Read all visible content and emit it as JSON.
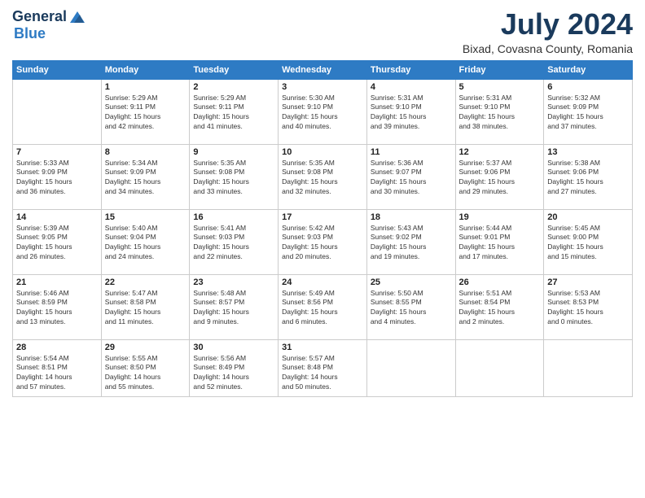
{
  "header": {
    "logo": {
      "line1": "General",
      "line2": "Blue"
    },
    "title": "July 2024",
    "location": "Bixad, Covasna County, Romania"
  },
  "weekdays": [
    "Sunday",
    "Monday",
    "Tuesday",
    "Wednesday",
    "Thursday",
    "Friday",
    "Saturday"
  ],
  "weeks": [
    [
      {
        "day": null,
        "info": null
      },
      {
        "day": "1",
        "info": "Sunrise: 5:29 AM\nSunset: 9:11 PM\nDaylight: 15 hours\nand 42 minutes."
      },
      {
        "day": "2",
        "info": "Sunrise: 5:29 AM\nSunset: 9:11 PM\nDaylight: 15 hours\nand 41 minutes."
      },
      {
        "day": "3",
        "info": "Sunrise: 5:30 AM\nSunset: 9:10 PM\nDaylight: 15 hours\nand 40 minutes."
      },
      {
        "day": "4",
        "info": "Sunrise: 5:31 AM\nSunset: 9:10 PM\nDaylight: 15 hours\nand 39 minutes."
      },
      {
        "day": "5",
        "info": "Sunrise: 5:31 AM\nSunset: 9:10 PM\nDaylight: 15 hours\nand 38 minutes."
      },
      {
        "day": "6",
        "info": "Sunrise: 5:32 AM\nSunset: 9:09 PM\nDaylight: 15 hours\nand 37 minutes."
      }
    ],
    [
      {
        "day": "7",
        "info": "Sunrise: 5:33 AM\nSunset: 9:09 PM\nDaylight: 15 hours\nand 36 minutes."
      },
      {
        "day": "8",
        "info": "Sunrise: 5:34 AM\nSunset: 9:09 PM\nDaylight: 15 hours\nand 34 minutes."
      },
      {
        "day": "9",
        "info": "Sunrise: 5:35 AM\nSunset: 9:08 PM\nDaylight: 15 hours\nand 33 minutes."
      },
      {
        "day": "10",
        "info": "Sunrise: 5:35 AM\nSunset: 9:08 PM\nDaylight: 15 hours\nand 32 minutes."
      },
      {
        "day": "11",
        "info": "Sunrise: 5:36 AM\nSunset: 9:07 PM\nDaylight: 15 hours\nand 30 minutes."
      },
      {
        "day": "12",
        "info": "Sunrise: 5:37 AM\nSunset: 9:06 PM\nDaylight: 15 hours\nand 29 minutes."
      },
      {
        "day": "13",
        "info": "Sunrise: 5:38 AM\nSunset: 9:06 PM\nDaylight: 15 hours\nand 27 minutes."
      }
    ],
    [
      {
        "day": "14",
        "info": "Sunrise: 5:39 AM\nSunset: 9:05 PM\nDaylight: 15 hours\nand 26 minutes."
      },
      {
        "day": "15",
        "info": "Sunrise: 5:40 AM\nSunset: 9:04 PM\nDaylight: 15 hours\nand 24 minutes."
      },
      {
        "day": "16",
        "info": "Sunrise: 5:41 AM\nSunset: 9:03 PM\nDaylight: 15 hours\nand 22 minutes."
      },
      {
        "day": "17",
        "info": "Sunrise: 5:42 AM\nSunset: 9:03 PM\nDaylight: 15 hours\nand 20 minutes."
      },
      {
        "day": "18",
        "info": "Sunrise: 5:43 AM\nSunset: 9:02 PM\nDaylight: 15 hours\nand 19 minutes."
      },
      {
        "day": "19",
        "info": "Sunrise: 5:44 AM\nSunset: 9:01 PM\nDaylight: 15 hours\nand 17 minutes."
      },
      {
        "day": "20",
        "info": "Sunrise: 5:45 AM\nSunset: 9:00 PM\nDaylight: 15 hours\nand 15 minutes."
      }
    ],
    [
      {
        "day": "21",
        "info": "Sunrise: 5:46 AM\nSunset: 8:59 PM\nDaylight: 15 hours\nand 13 minutes."
      },
      {
        "day": "22",
        "info": "Sunrise: 5:47 AM\nSunset: 8:58 PM\nDaylight: 15 hours\nand 11 minutes."
      },
      {
        "day": "23",
        "info": "Sunrise: 5:48 AM\nSunset: 8:57 PM\nDaylight: 15 hours\nand 9 minutes."
      },
      {
        "day": "24",
        "info": "Sunrise: 5:49 AM\nSunset: 8:56 PM\nDaylight: 15 hours\nand 6 minutes."
      },
      {
        "day": "25",
        "info": "Sunrise: 5:50 AM\nSunset: 8:55 PM\nDaylight: 15 hours\nand 4 minutes."
      },
      {
        "day": "26",
        "info": "Sunrise: 5:51 AM\nSunset: 8:54 PM\nDaylight: 15 hours\nand 2 minutes."
      },
      {
        "day": "27",
        "info": "Sunrise: 5:53 AM\nSunset: 8:53 PM\nDaylight: 15 hours\nand 0 minutes."
      }
    ],
    [
      {
        "day": "28",
        "info": "Sunrise: 5:54 AM\nSunset: 8:51 PM\nDaylight: 14 hours\nand 57 minutes."
      },
      {
        "day": "29",
        "info": "Sunrise: 5:55 AM\nSunset: 8:50 PM\nDaylight: 14 hours\nand 55 minutes."
      },
      {
        "day": "30",
        "info": "Sunrise: 5:56 AM\nSunset: 8:49 PM\nDaylight: 14 hours\nand 52 minutes."
      },
      {
        "day": "31",
        "info": "Sunrise: 5:57 AM\nSunset: 8:48 PM\nDaylight: 14 hours\nand 50 minutes."
      },
      {
        "day": null,
        "info": null
      },
      {
        "day": null,
        "info": null
      },
      {
        "day": null,
        "info": null
      }
    ]
  ]
}
